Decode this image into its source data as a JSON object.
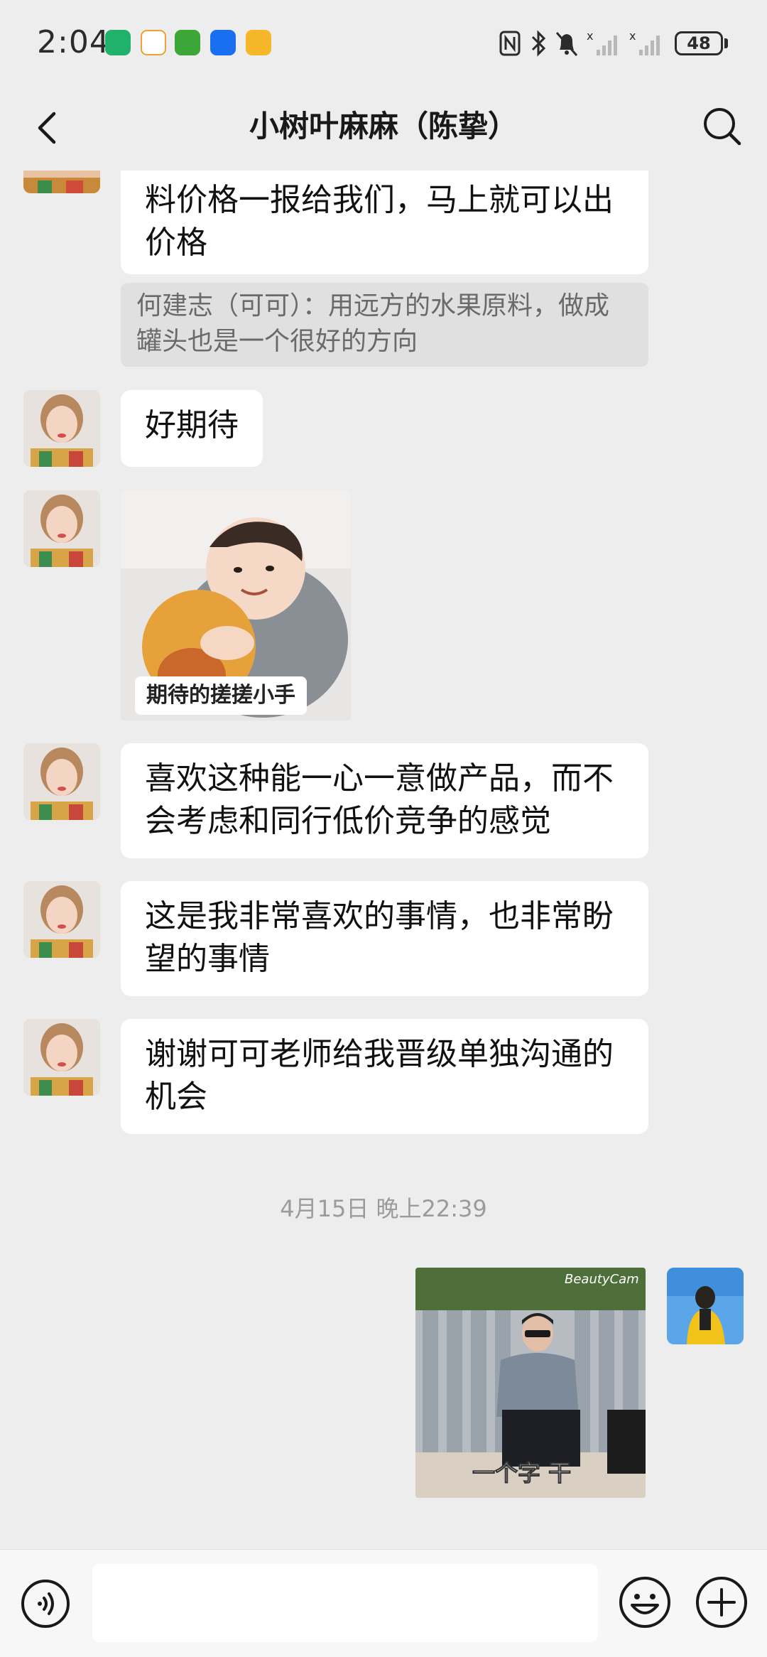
{
  "status_bar": {
    "time": "2:04",
    "battery": "48"
  },
  "header": {
    "title": "小树叶麻麻（陈挚）"
  },
  "messages": [
    {
      "text": "料价格一报给我们，马上就可以出价格"
    },
    {
      "quote": "何建志（可可）：用远方的水果原料，做成罐头也是一个很好的方向"
    },
    {
      "text": "好期待"
    },
    {
      "sticker_caption": "期待的搓搓小手"
    },
    {
      "text": "喜欢这种能一心一意做产品，而不会考虑和同行低价竞争的感觉"
    },
    {
      "text": "这是我非常喜欢的事情，也非常盼望的事情"
    },
    {
      "text": "谢谢可可老师给我晋级单独沟通的机会"
    }
  ],
  "timestamp": "4月15日 晚上22:39",
  "sent_sticker": {
    "caption": "一个字 干",
    "watermark": "BeautyCam"
  },
  "colors": {
    "background": "#ededed",
    "bubble": "#ffffff",
    "quote_bg": "#e0e0e0"
  }
}
